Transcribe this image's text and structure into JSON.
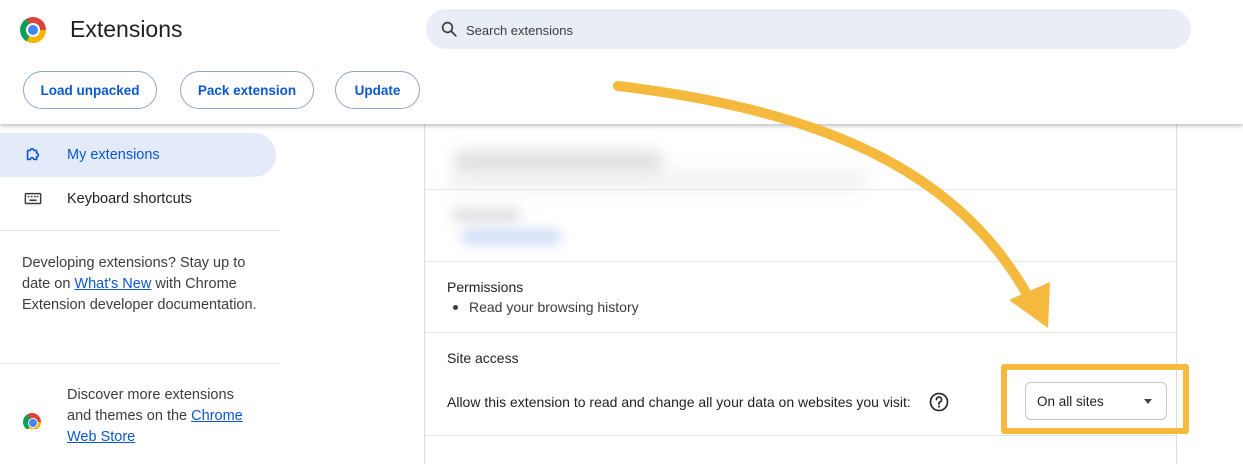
{
  "header": {
    "title": "Extensions",
    "logo_icon": "chrome-logo",
    "search": {
      "placeholder": "Search extensions",
      "value": ""
    }
  },
  "toolbar": {
    "load_unpacked": "Load unpacked",
    "pack_extension": "Pack extension",
    "update": "Update"
  },
  "sidebar": {
    "items": [
      {
        "label": "My extensions",
        "icon": "extension-puzzle-icon",
        "active": true
      },
      {
        "label": "Keyboard shortcuts",
        "icon": "keyboard-icon",
        "active": false
      }
    ],
    "dev_text_before": "Developing extensions? Stay up to date on ",
    "dev_link": "What's New",
    "dev_text_after": " with Chrome Extension developer documentation.",
    "store_text": "Discover more extensions and themes on the ",
    "store_link": "Chrome Web Store"
  },
  "details": {
    "permissions_title": "Permissions",
    "permissions": [
      "Read your browsing history"
    ],
    "site_access_title": "Site access",
    "allow_text": "Allow this extension to read and change all your data on websites you visit:",
    "site_access_value": "On all sites"
  },
  "colors": {
    "accent": "#0b57d0",
    "annotation": "#f5b93d",
    "active_nav_bg": "#e3ebfb"
  }
}
